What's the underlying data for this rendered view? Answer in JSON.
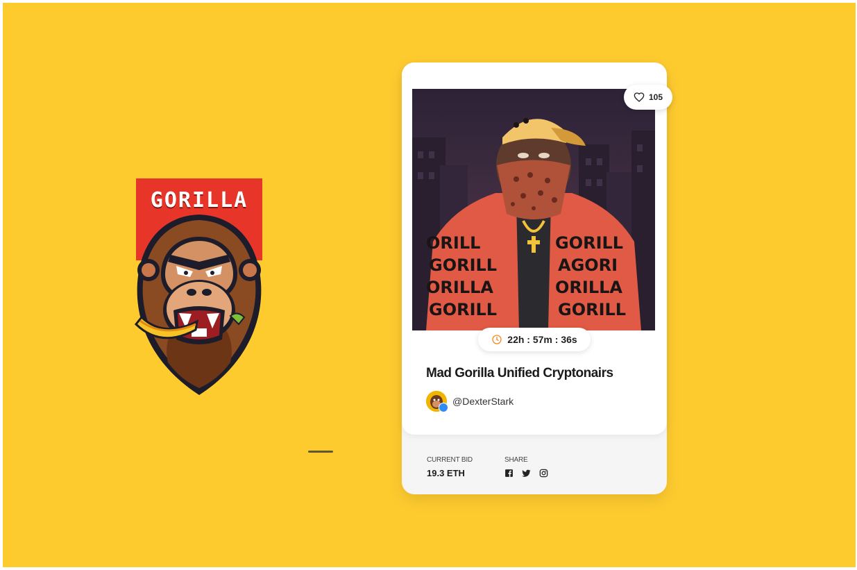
{
  "logo": {
    "word": "GORILLA"
  },
  "card": {
    "likes": "105",
    "timer": "22h : 57m : 36s",
    "title": "Mad Gorilla Unified Cryptonairs",
    "creator": "@DexterStark",
    "current_bid_label": "CURRENT BID",
    "current_bid_value": "19.3 ETH",
    "share_label": "SHARE",
    "share_icons": [
      "facebook-icon",
      "twitter-icon",
      "instagram-icon"
    ],
    "art_jacket_text": "GORILLA"
  },
  "colors": {
    "background": "#fecb2f",
    "banner_red": "#e8352a",
    "jacket": "#e05a45",
    "night_sky": "#3a2b41",
    "verified_blue": "#2f8cf5",
    "timer_orange": "#f28a1e"
  }
}
